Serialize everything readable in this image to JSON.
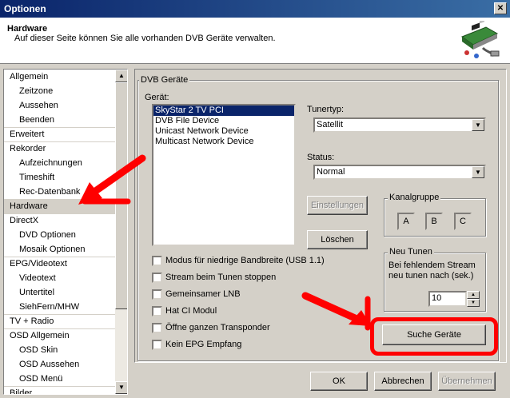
{
  "window": {
    "title": "Optionen",
    "close_glyph": "✕"
  },
  "header": {
    "title": "Hardware",
    "subtitle": "Auf dieser Seite können Sie alle vorhanden DVB Geräte verwalten.",
    "icon": "hardware-card-icon"
  },
  "tree": {
    "items": [
      {
        "label": "Allgemein",
        "level": 0
      },
      {
        "label": "Zeitzone",
        "level": 1
      },
      {
        "label": "Aussehen",
        "level": 1
      },
      {
        "label": "Beenden",
        "level": 1
      },
      {
        "label": "Erweitert",
        "level": 0
      },
      {
        "label": "Rekorder",
        "level": 0
      },
      {
        "label": "Aufzeichnungen",
        "level": 1
      },
      {
        "label": "Timeshift",
        "level": 1
      },
      {
        "label": "Rec-Datenbank",
        "level": 1
      },
      {
        "label": "Hardware",
        "level": 0,
        "selected": true
      },
      {
        "label": "DirectX",
        "level": 0
      },
      {
        "label": "DVD Optionen",
        "level": 1
      },
      {
        "label": "Mosaik Optionen",
        "level": 1
      },
      {
        "label": "EPG/Videotext",
        "level": 0
      },
      {
        "label": "Videotext",
        "level": 1
      },
      {
        "label": "Untertitel",
        "level": 1
      },
      {
        "label": "SiehFern/MHW",
        "level": 1
      },
      {
        "label": "TV + Radio",
        "level": 0
      },
      {
        "label": "OSD Allgemein",
        "level": 0
      },
      {
        "label": "OSD Skin",
        "level": 1
      },
      {
        "label": "OSD Aussehen",
        "level": 1
      },
      {
        "label": "OSD Menü",
        "level": 1
      },
      {
        "label": "Bilder",
        "level": 0
      }
    ]
  },
  "panel": {
    "group_title": "DVB Geräte",
    "device_label": "Gerät:",
    "devices": [
      "SkyStar 2 TV PCI",
      "DVB File Device",
      "Unicast Network Device",
      "Multicast Network Device"
    ],
    "tunertyp_label": "Tunertyp:",
    "tunertyp_value": "Satellit",
    "status_label": "Status:",
    "status_value": "Normal",
    "einstellungen_label": "Einstellungen",
    "loeschen_label": "Löschen",
    "kanalgruppe_title": "Kanalgruppe",
    "kanalgruppe_buttons": [
      "A",
      "B",
      "C"
    ],
    "neu_tunen_title": "Neu Tunen",
    "neu_tunen_text1": "Bei fehlendem Stream",
    "neu_tunen_text2": "neu tunen nach (sek.)",
    "neu_tunen_value": "10",
    "checkboxes": [
      "Modus für niedrige Bandbreite (USB 1.1)",
      "Stream beim Tunen stoppen",
      "Gemeinsamer LNB",
      "Hat CI Modul",
      "Öffne ganzen Transponder",
      "Kein EPG Empfang"
    ],
    "suche_label": "Suche Geräte"
  },
  "footer": {
    "ok_label": "OK",
    "cancel_label": "Abbrechen",
    "apply_label": "Übernehmen"
  },
  "colors": {
    "selection": "#0a246a",
    "annotation": "#ff0000",
    "face": "#d4d0c8"
  }
}
